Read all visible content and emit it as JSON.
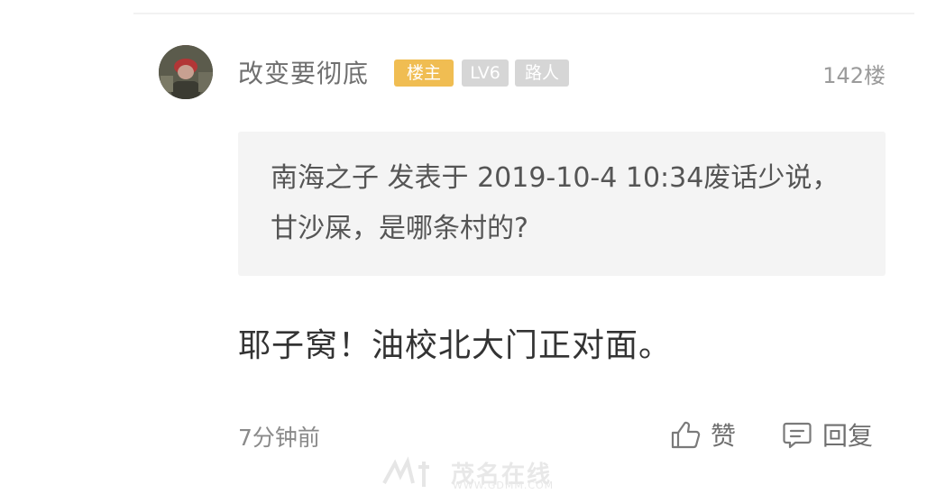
{
  "comment": {
    "username": "改变要彻底",
    "badges": {
      "owner": "楼主",
      "level": "LV6",
      "rank": "路人"
    },
    "floor": "142楼",
    "quote": {
      "text": "南海之子 发表于 2019-10-4 10:34废话少说，甘沙屎，是哪条村的?"
    },
    "content": "耶子窝！油校北大门正对面。",
    "timestamp": "7分钟前",
    "actions": {
      "like_label": "赞",
      "reply_label": "回复"
    }
  },
  "watermark": {
    "logo_text": "茂名在线",
    "url": "WWW.GDMM.COM"
  },
  "colors": {
    "owner_badge": "#f0bd52",
    "gray_badge": "#d6d6d6",
    "quote_background": "#f4f4f4"
  }
}
